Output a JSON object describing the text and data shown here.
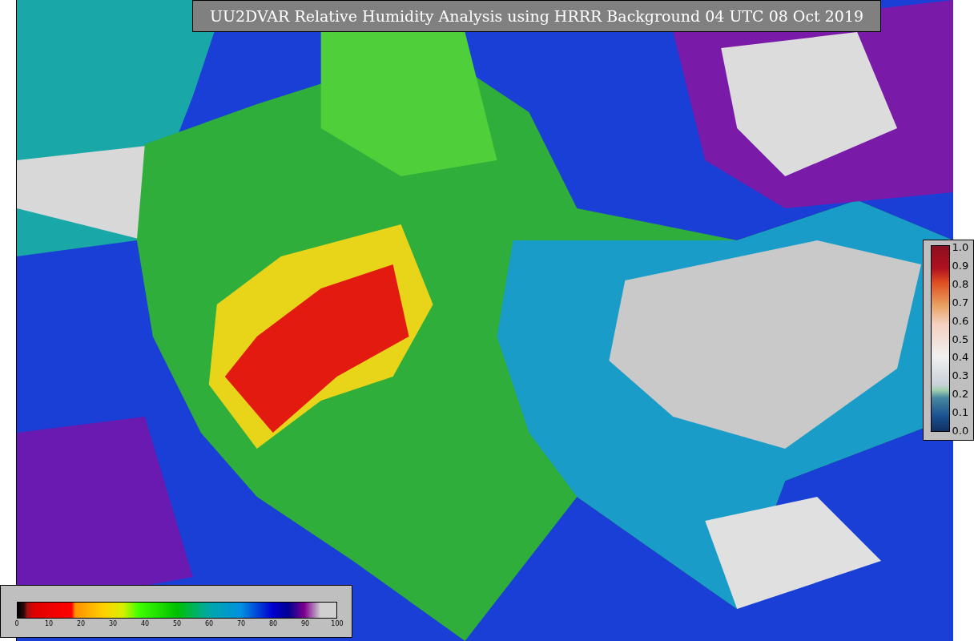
{
  "title": "UU2DVAR Relative Humidity Analysis using HRRR Background 04 UTC 08 Oct 2019",
  "humidity_colorbar": {
    "ticks": [
      "0",
      "10",
      "20",
      "30",
      "40",
      "50",
      "60",
      "70",
      "80",
      "90",
      "100"
    ]
  },
  "observation_colorbar": {
    "ticks": [
      "1.0",
      "0.9",
      "0.8",
      "0.7",
      "0.6",
      "0.5",
      "0.4",
      "0.3",
      "0.2",
      "0.1",
      "0.0"
    ]
  }
}
